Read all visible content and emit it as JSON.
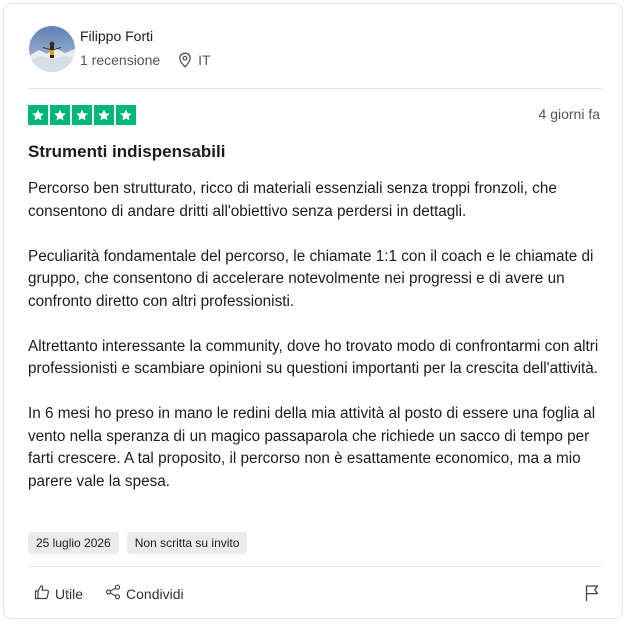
{
  "reviewer": {
    "name": "Filippo Forti",
    "reviews_count": "1 recensione",
    "country": "IT",
    "avatar_icon": "user-avatar-photo",
    "location_icon": "map-pin-icon"
  },
  "review": {
    "rating": 5,
    "rating_max": 5,
    "star_color": "#00b67a",
    "relative_date": "4 giorni fa",
    "title": "Strumenti indispensabili",
    "paragraphs": [
      "Percorso ben strutturato, ricco di materiali essenziali senza troppi fronzoli, che consentono di andare dritti all'obiettivo senza perdersi in dettagli.",
      "Peculiarità fondamentale del percorso, le chiamate 1:1 con il coach e le chiamate di gruppo, che consentono di accelerare notevolmente nei progressi e di avere un confronto diretto con altri professionisti.",
      "Altrettanto interessante la community, dove ho trovato modo di confrontarmi con altri professionisti e scambiare opinioni su questioni importanti per la crescita dell'attività.",
      "In 6 mesi ho preso in mano le redini della mia attività al posto di essere una foglia al vento nella speranza di un magico passaparola che richiede un sacco di tempo per farti crescere. A tal proposito, il percorso non è esattamente economico, ma a mio parere vale la spesa."
    ],
    "experience_date": "25 luglio 2026",
    "invite_label": "Non scritta su invito"
  },
  "actions": {
    "useful_label": "Utile",
    "share_label": "Condividi",
    "useful_icon": "thumbs-up-icon",
    "share_icon": "share-icon",
    "flag_icon": "flag-icon"
  }
}
